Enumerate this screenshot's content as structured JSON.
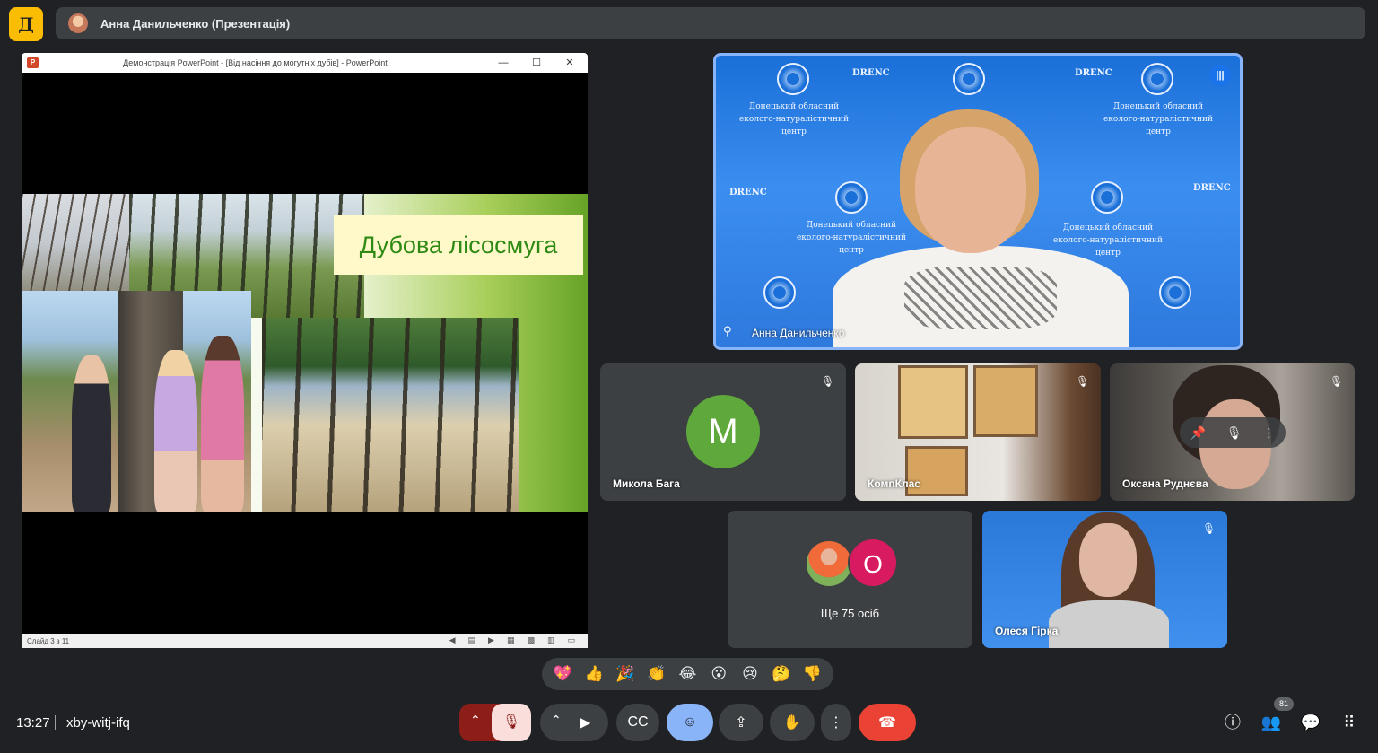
{
  "app": {
    "logo_letter": "Д"
  },
  "header": {
    "title": "Анна Данильченко (Презентація)"
  },
  "presentation": {
    "window_title": "Демонстрація PowerPoint - [Від насіння до могутніх дубів] - PowerPoint",
    "app_badge": "P",
    "slide_title": "Дубова лісосмуга",
    "status": "Слайд 3 з 11",
    "controls": {
      "minimize": "—",
      "maximize": "☐",
      "close": "✕"
    }
  },
  "main_speaker": {
    "name": "Анна Данильченко",
    "org_text": "Донецький обласний еколого-натуралістичний центр",
    "org_short": "DRENC"
  },
  "participants": [
    {
      "name": "Микола Бага",
      "avatar_letter": "М",
      "color": "#5fa83b",
      "muted": true
    },
    {
      "name": "КомпКлас",
      "muted": true
    },
    {
      "name": "Оксана Руднєва",
      "muted": true
    },
    {
      "name": "Олеся Гірка",
      "muted": true
    }
  ],
  "more_tile": {
    "text": "Ще 75 осіб",
    "avatar_letter": "О"
  },
  "reactions": [
    "💖",
    "👍",
    "🎉",
    "👏",
    "😂",
    "😮",
    "😢",
    "🤔",
    "👎"
  ],
  "bottom_bar": {
    "time": "13:27",
    "meeting_code": "xby-witj-ifq",
    "participants_count": "81"
  },
  "colors": {
    "accent": "#8ab4f8",
    "leave": "#ea4335",
    "active": "#8ab4f8",
    "mic_off": "#f9dedc"
  }
}
